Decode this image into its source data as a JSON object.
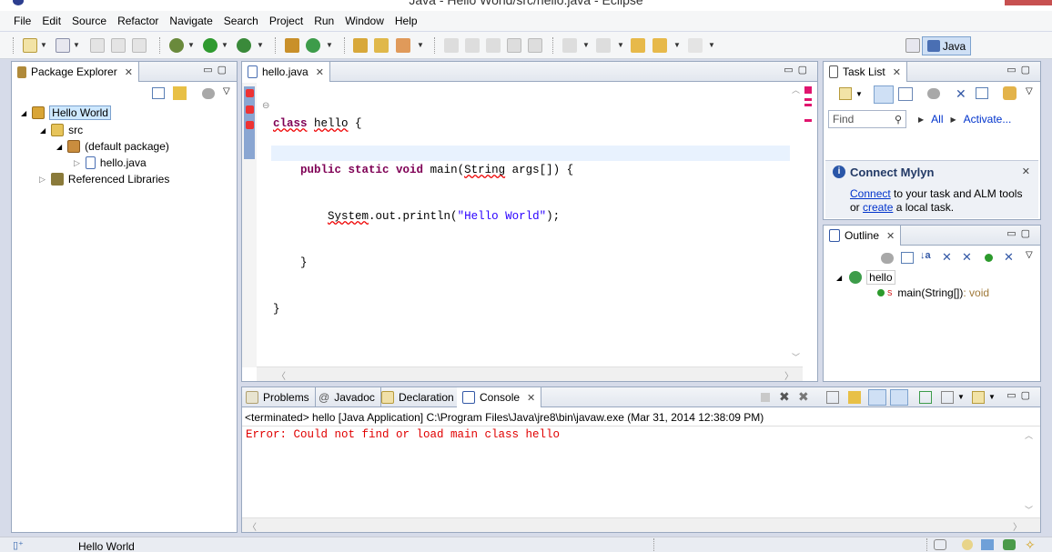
{
  "window": {
    "title": "Java - Hello World/src/hello.java - Eclipse"
  },
  "menu": [
    "File",
    "Edit",
    "Source",
    "Refactor",
    "Navigate",
    "Search",
    "Project",
    "Run",
    "Window",
    "Help"
  ],
  "perspective": {
    "label": "Java"
  },
  "package_explorer": {
    "tab_label": "Package Explorer",
    "tree": [
      {
        "label": "Hello World"
      },
      {
        "label": "src"
      },
      {
        "label": "(default package)"
      },
      {
        "label": "hello.java"
      },
      {
        "label": "Referenced Libraries"
      }
    ]
  },
  "editor": {
    "tab_label": "hello.java",
    "lines": [
      {
        "kw": "class",
        "name": "hello",
        "rest": " {"
      },
      {
        "kw": "public static void",
        "name": "main",
        "p1": "(",
        "type": "String",
        "p2": " args[]) {"
      },
      {
        "obj": "System",
        "rest": ".out.println(",
        "str": "\"Hello World\"",
        "end": ");"
      },
      {
        "text": "}"
      },
      {
        "text": "}"
      }
    ]
  },
  "task_list": {
    "tab_label": "Task List",
    "find_placeholder": "Find",
    "all_label": "All",
    "activate_label": "Activate..."
  },
  "mylyn": {
    "title": "Connect Mylyn",
    "connect_link": "Connect",
    "line1_rest": " to your task and ALM tools",
    "line2_prefix": "or ",
    "create_link": "create",
    "line2_rest": " a local task."
  },
  "outline": {
    "tab_label": "Outline",
    "class_label": "hello",
    "method_label": "main(String[])",
    "method_type": " : void"
  },
  "bottom_tabs": [
    "Problems",
    "Javadoc",
    "Declaration",
    "Console"
  ],
  "console": {
    "header": "<terminated> hello [Java Application] C:\\Program Files\\Java\\jre8\\bin\\javaw.exe (Mar 31, 2014 12:38:09 PM)",
    "error": "Error: Could not find or load main class hello"
  },
  "status": {
    "text": "Hello World"
  },
  "colors": {
    "error": "#e00000",
    "keyword": "#7f0055",
    "string": "#2a00ff",
    "selection": "#cde8ff"
  }
}
